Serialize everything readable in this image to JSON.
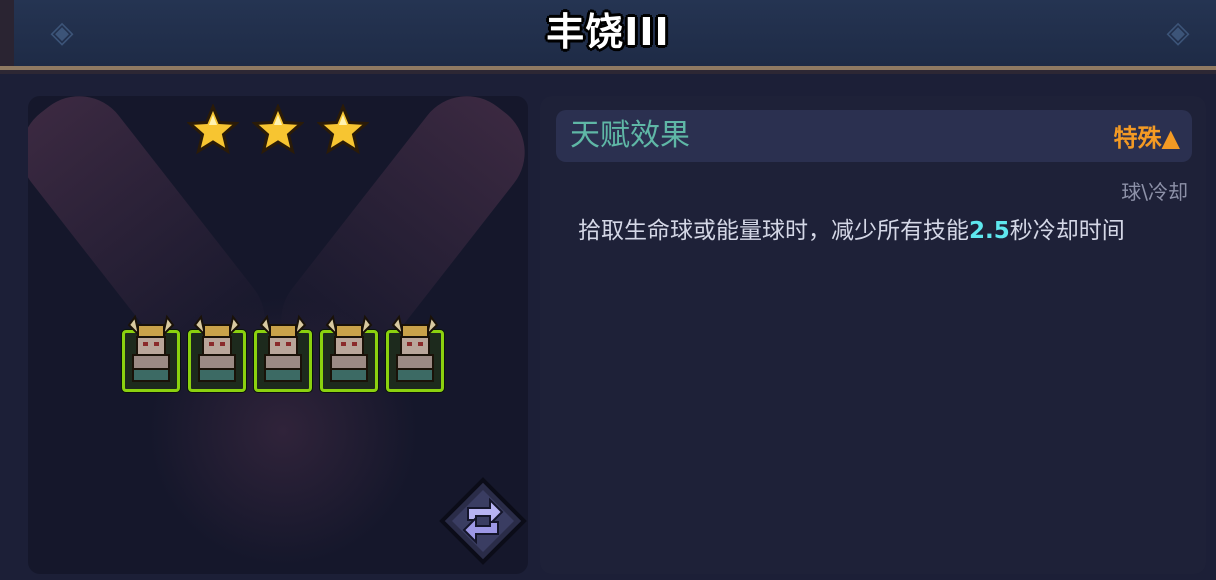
{
  "header": {
    "title": "丰饶III"
  },
  "left_panel": {
    "star_rating": 3,
    "star_icon": "star-icon",
    "units_count": 5,
    "unit_icon": "horned-warrior-icon",
    "swap_icon": "swap-arrows-icon"
  },
  "talent": {
    "section_title": "天赋效果",
    "type_label": "特殊▲",
    "tag": "球\\冷却",
    "desc_before": "拾取生命球或能量球时，减少所有技能",
    "desc_value": "2.5",
    "desc_after": "秒冷却时间"
  },
  "colors": {
    "background": "#1c1f37",
    "title_text": "#ffffff",
    "section_title": "#5fb7a6",
    "type_label": "#f39a24",
    "highlight_value": "#5ee7ee",
    "unit_border": "#8bd10f",
    "star": "#f7c531"
  }
}
